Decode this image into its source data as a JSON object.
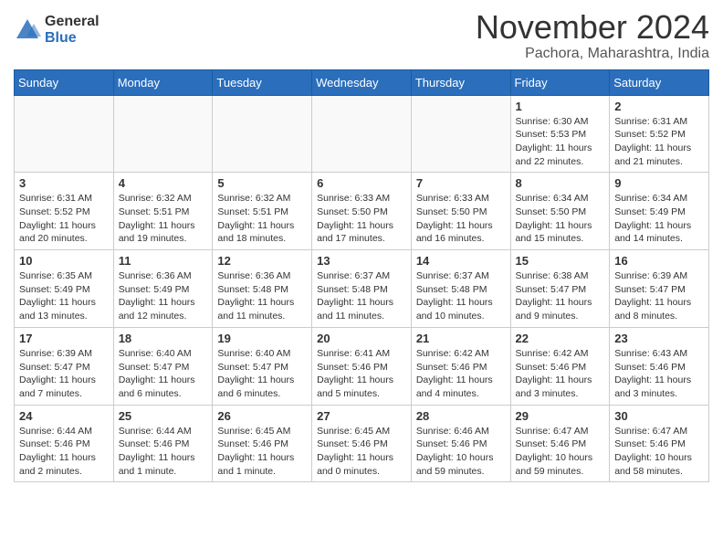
{
  "logo": {
    "general": "General",
    "blue": "Blue"
  },
  "title": "November 2024",
  "location": "Pachora, Maharashtra, India",
  "weekdays": [
    "Sunday",
    "Monday",
    "Tuesday",
    "Wednesday",
    "Thursday",
    "Friday",
    "Saturday"
  ],
  "weeks": [
    [
      {
        "day": "",
        "info": ""
      },
      {
        "day": "",
        "info": ""
      },
      {
        "day": "",
        "info": ""
      },
      {
        "day": "",
        "info": ""
      },
      {
        "day": "",
        "info": ""
      },
      {
        "day": "1",
        "info": "Sunrise: 6:30 AM\nSunset: 5:53 PM\nDaylight: 11 hours\nand 22 minutes."
      },
      {
        "day": "2",
        "info": "Sunrise: 6:31 AM\nSunset: 5:52 PM\nDaylight: 11 hours\nand 21 minutes."
      }
    ],
    [
      {
        "day": "3",
        "info": "Sunrise: 6:31 AM\nSunset: 5:52 PM\nDaylight: 11 hours\nand 20 minutes."
      },
      {
        "day": "4",
        "info": "Sunrise: 6:32 AM\nSunset: 5:51 PM\nDaylight: 11 hours\nand 19 minutes."
      },
      {
        "day": "5",
        "info": "Sunrise: 6:32 AM\nSunset: 5:51 PM\nDaylight: 11 hours\nand 18 minutes."
      },
      {
        "day": "6",
        "info": "Sunrise: 6:33 AM\nSunset: 5:50 PM\nDaylight: 11 hours\nand 17 minutes."
      },
      {
        "day": "7",
        "info": "Sunrise: 6:33 AM\nSunset: 5:50 PM\nDaylight: 11 hours\nand 16 minutes."
      },
      {
        "day": "8",
        "info": "Sunrise: 6:34 AM\nSunset: 5:50 PM\nDaylight: 11 hours\nand 15 minutes."
      },
      {
        "day": "9",
        "info": "Sunrise: 6:34 AM\nSunset: 5:49 PM\nDaylight: 11 hours\nand 14 minutes."
      }
    ],
    [
      {
        "day": "10",
        "info": "Sunrise: 6:35 AM\nSunset: 5:49 PM\nDaylight: 11 hours\nand 13 minutes."
      },
      {
        "day": "11",
        "info": "Sunrise: 6:36 AM\nSunset: 5:49 PM\nDaylight: 11 hours\nand 12 minutes."
      },
      {
        "day": "12",
        "info": "Sunrise: 6:36 AM\nSunset: 5:48 PM\nDaylight: 11 hours\nand 11 minutes."
      },
      {
        "day": "13",
        "info": "Sunrise: 6:37 AM\nSunset: 5:48 PM\nDaylight: 11 hours\nand 11 minutes."
      },
      {
        "day": "14",
        "info": "Sunrise: 6:37 AM\nSunset: 5:48 PM\nDaylight: 11 hours\nand 10 minutes."
      },
      {
        "day": "15",
        "info": "Sunrise: 6:38 AM\nSunset: 5:47 PM\nDaylight: 11 hours\nand 9 minutes."
      },
      {
        "day": "16",
        "info": "Sunrise: 6:39 AM\nSunset: 5:47 PM\nDaylight: 11 hours\nand 8 minutes."
      }
    ],
    [
      {
        "day": "17",
        "info": "Sunrise: 6:39 AM\nSunset: 5:47 PM\nDaylight: 11 hours\nand 7 minutes."
      },
      {
        "day": "18",
        "info": "Sunrise: 6:40 AM\nSunset: 5:47 PM\nDaylight: 11 hours\nand 6 minutes."
      },
      {
        "day": "19",
        "info": "Sunrise: 6:40 AM\nSunset: 5:47 PM\nDaylight: 11 hours\nand 6 minutes."
      },
      {
        "day": "20",
        "info": "Sunrise: 6:41 AM\nSunset: 5:46 PM\nDaylight: 11 hours\nand 5 minutes."
      },
      {
        "day": "21",
        "info": "Sunrise: 6:42 AM\nSunset: 5:46 PM\nDaylight: 11 hours\nand 4 minutes."
      },
      {
        "day": "22",
        "info": "Sunrise: 6:42 AM\nSunset: 5:46 PM\nDaylight: 11 hours\nand 3 minutes."
      },
      {
        "day": "23",
        "info": "Sunrise: 6:43 AM\nSunset: 5:46 PM\nDaylight: 11 hours\nand 3 minutes."
      }
    ],
    [
      {
        "day": "24",
        "info": "Sunrise: 6:44 AM\nSunset: 5:46 PM\nDaylight: 11 hours\nand 2 minutes."
      },
      {
        "day": "25",
        "info": "Sunrise: 6:44 AM\nSunset: 5:46 PM\nDaylight: 11 hours\nand 1 minute."
      },
      {
        "day": "26",
        "info": "Sunrise: 6:45 AM\nSunset: 5:46 PM\nDaylight: 11 hours\nand 1 minute."
      },
      {
        "day": "27",
        "info": "Sunrise: 6:45 AM\nSunset: 5:46 PM\nDaylight: 11 hours\nand 0 minutes."
      },
      {
        "day": "28",
        "info": "Sunrise: 6:46 AM\nSunset: 5:46 PM\nDaylight: 10 hours\nand 59 minutes."
      },
      {
        "day": "29",
        "info": "Sunrise: 6:47 AM\nSunset: 5:46 PM\nDaylight: 10 hours\nand 59 minutes."
      },
      {
        "day": "30",
        "info": "Sunrise: 6:47 AM\nSunset: 5:46 PM\nDaylight: 10 hours\nand 58 minutes."
      }
    ]
  ]
}
